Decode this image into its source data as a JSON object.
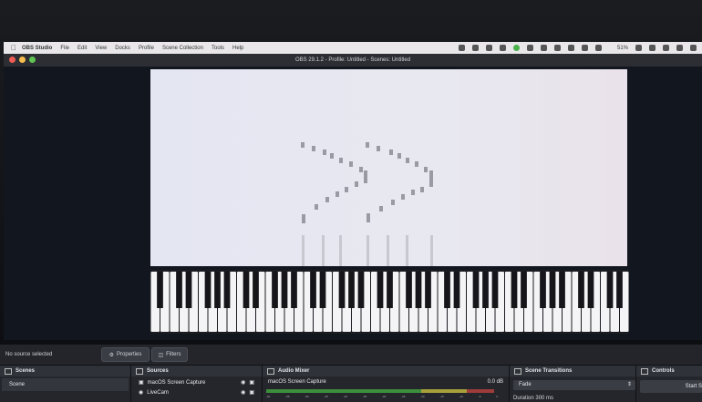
{
  "menubar": {
    "app": "OBS Studio",
    "items": [
      "File",
      "Edit",
      "View",
      "Docks",
      "Profile",
      "Scene Collection",
      "Tools",
      "Help"
    ],
    "battery": "51%"
  },
  "window": {
    "title": "OBS 29.1.2 - Profile: Untitled - Scenes: Untitled"
  },
  "status": {
    "no_source": "No source selected",
    "properties": "Properties",
    "filters": "Filters"
  },
  "docks": {
    "scenes": {
      "title": "Scenes",
      "items": [
        "Scene"
      ]
    },
    "sources": {
      "title": "Sources",
      "items": [
        "macOS Screen Capture",
        "LiveCam"
      ]
    },
    "audio": {
      "title": "Audio Mixer",
      "track": "macOS Screen Capture",
      "level": "0.0 dB",
      "ticks": [
        "-60",
        "-55",
        "-50",
        "-45",
        "-40",
        "-35",
        "-30",
        "-25",
        "-20",
        "-15",
        "-10",
        "-5",
        "0"
      ]
    },
    "transitions": {
      "title": "Scene Transitions",
      "selected": "Fade",
      "duration_label": "Duration",
      "duration": "300 ms"
    },
    "controls": {
      "title": "Controls",
      "start": "Start S"
    }
  },
  "colors": {
    "accent_green": "#49b24a",
    "panel": "#24262c"
  }
}
